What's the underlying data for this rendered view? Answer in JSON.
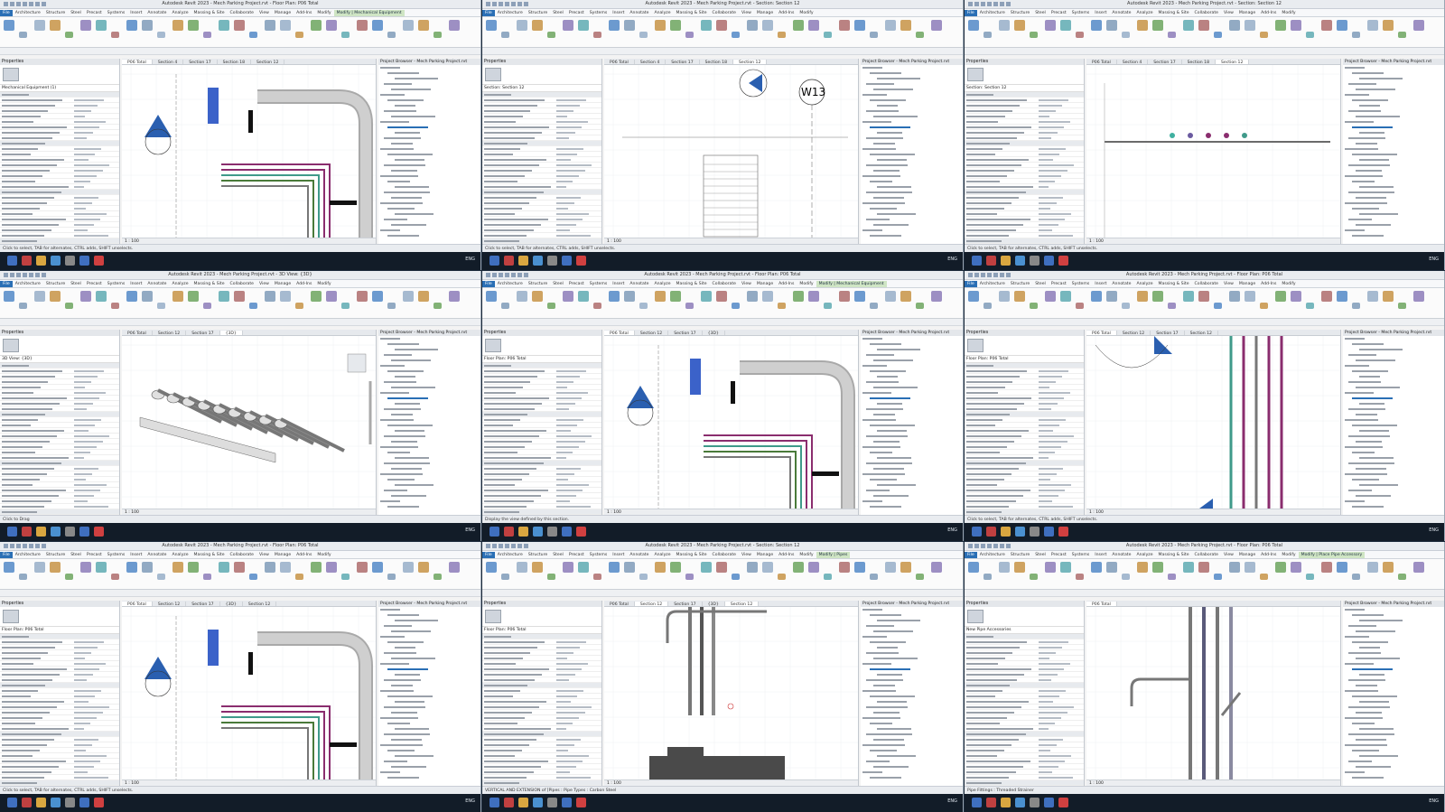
{
  "app": {
    "brand_color": "#2a6fb5",
    "context_tab_color": "#cfe5c4"
  },
  "ribbon_tabs": [
    "File",
    "Architecture",
    "Structure",
    "Steel",
    "Precast",
    "Systems",
    "Insert",
    "Annotate",
    "Analyze",
    "Massing & Site",
    "Collaborate",
    "View",
    "Manage",
    "Add-Ins",
    "Modify"
  ],
  "windows": [
    {
      "title": "Autodesk Revit 2023 - Mech Parking Project.rvt - Floor Plan: P06 Total",
      "context_tab": "Modify | Mechanical Equipment",
      "view_tabs": [
        "P06 Total",
        "Section 4",
        "Section 17",
        "Section 18",
        "Section 12"
      ],
      "active_view": "P06 Total",
      "properties_type": "Mechanical Equipment (1)",
      "view_scale": "1 : 100",
      "status": "Click to select, TAB for alternates, CTRL adds, SHIFT unselects.",
      "canvas_label": ""
    },
    {
      "title": "Autodesk Revit 2023 - Mech Parking Project.rvt - Section: Section 12",
      "context_tab": "",
      "view_tabs": [
        "P06 Total",
        "Section 4",
        "Section 17",
        "Section 18",
        "Section 12"
      ],
      "active_view": "Section 12",
      "properties_type": "Section: Section 12",
      "view_scale": "1 : 100",
      "status": "Click to select, TAB for alternates, CTRL adds, SHIFT unselects.",
      "canvas_label": "W13"
    },
    {
      "title": "Autodesk Revit 2023 - Mech Parking Project.rvt - Section: Section 12",
      "context_tab": "",
      "view_tabs": [
        "P06 Total",
        "Section 4",
        "Section 17",
        "Section 18",
        "Section 12"
      ],
      "active_view": "Section 12",
      "properties_type": "Section: Section 12",
      "view_scale": "1 : 100",
      "status": "Click to select, TAB for alternates, CTRL adds, SHIFT unselects.",
      "canvas_label": ""
    },
    {
      "title": "Autodesk Revit 2023 - Mech Parking Project.rvt - 3D View: {3D}",
      "context_tab": "",
      "view_tabs": [
        "P06 Total",
        "Section 12",
        "Section 17",
        "{3D}"
      ],
      "active_view": "{3D}",
      "properties_type": "3D View: {3D}",
      "view_scale": "1 : 100",
      "status": "Click to Drag",
      "canvas_label": ""
    },
    {
      "title": "Autodesk Revit 2023 - Mech Parking Project.rvt - Floor Plan: P06 Total",
      "context_tab": "Modify | Mechanical Equipment",
      "view_tabs": [
        "P06 Total",
        "Section 12",
        "Section 17",
        "{3D}"
      ],
      "active_view": "P06 Total",
      "properties_type": "Floor Plan: P06 Total",
      "view_scale": "1 : 100",
      "status": "Display the view defined by this section.",
      "canvas_label": ""
    },
    {
      "title": "Autodesk Revit 2023 - Mech Parking Project.rvt - Floor Plan: P06 Total",
      "context_tab": "",
      "view_tabs": [
        "P06 Total",
        "Section 12",
        "Section 17",
        "Section 12"
      ],
      "active_view": "P06 Total",
      "properties_type": "Floor Plan: P06 Total",
      "view_scale": "1 : 100",
      "status": "Click to select, TAB for alternates, CTRL adds, SHIFT unselects.",
      "canvas_label": ""
    },
    {
      "title": "Autodesk Revit 2023 - Mech Parking Project.rvt - Floor Plan: P06 Total",
      "context_tab": "",
      "view_tabs": [
        "P06 Total",
        "Section 12",
        "Section 17",
        "{3D}",
        "Section 12"
      ],
      "active_view": "P06 Total",
      "properties_type": "Floor Plan: P06 Total",
      "view_scale": "1 : 100",
      "status": "Click to select, TAB for alternates, CTRL adds, SHIFT unselects.",
      "canvas_label": ""
    },
    {
      "title": "Autodesk Revit 2023 - Mech Parking Project.rvt - Section: Section 12",
      "context_tab": "Modify | Pipes",
      "view_tabs": [
        "P06 Total",
        "Section 12",
        "Section 17",
        "{3D}",
        "Section 12"
      ],
      "active_view": "Section 12",
      "properties_type": "Floor Plan: P06 Total",
      "view_scale": "1 : 100",
      "status": "VERTICAL AND EXTENSION of [Pipes : Pipe Types : Carbon Steel",
      "canvas_label": ""
    },
    {
      "title": "Autodesk Revit 2023 - Mech Parking Project.rvt - Floor Plan: P06 Total",
      "context_tab": "Modify | Place Pipe Accessory",
      "view_tabs": [
        "P06 Total"
      ],
      "active_view": "P06 Total",
      "properties_type": "New Pipe Accessories",
      "view_scale": "1 : 100",
      "status": "Pipe Fittings : Threaded Strainer",
      "canvas_label": ""
    }
  ],
  "project_browser": {
    "title": "Project Browser - Mech Parking Project.rvt"
  },
  "properties_header": "Properties",
  "edit_type_label": "Edit Type",
  "taskbar": {
    "time": "ENG"
  }
}
